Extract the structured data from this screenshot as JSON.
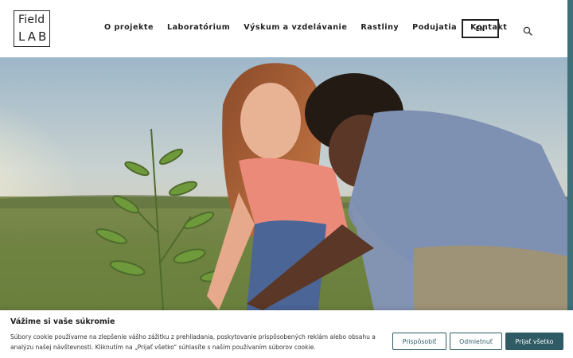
{
  "logo": {
    "top": "Field",
    "bottom": "LAB"
  },
  "nav": {
    "items": [
      {
        "label": "O projekte"
      },
      {
        "label": "Laboratórium"
      },
      {
        "label": "Výskum a vzdelávanie"
      },
      {
        "label": "Rastliny"
      },
      {
        "label": "Podujatia"
      },
      {
        "label": "Kontakt"
      }
    ],
    "lang_label": "EN",
    "search_icon": "search-icon"
  },
  "hero": {
    "image": "two young people planting a seedling in a field at sunset"
  },
  "cookie": {
    "title": "Vážime si vaše súkromie",
    "text": "Súbory cookie používame na zlepšenie vášho zážitku z prehliadania, poskytovanie prispôsobených reklám alebo obsahu a analýzu našej návštevnosti. Kliknutím na „Prijať všetko“ súhlasíte s naším používaním súborov cookie.",
    "customize_label": "Prispôsobiť",
    "reject_label": "Odmietnuť",
    "accept_label": "Prijať všetko"
  },
  "colors": {
    "accent": "#2f5b64",
    "strip": "#3f6f78"
  }
}
